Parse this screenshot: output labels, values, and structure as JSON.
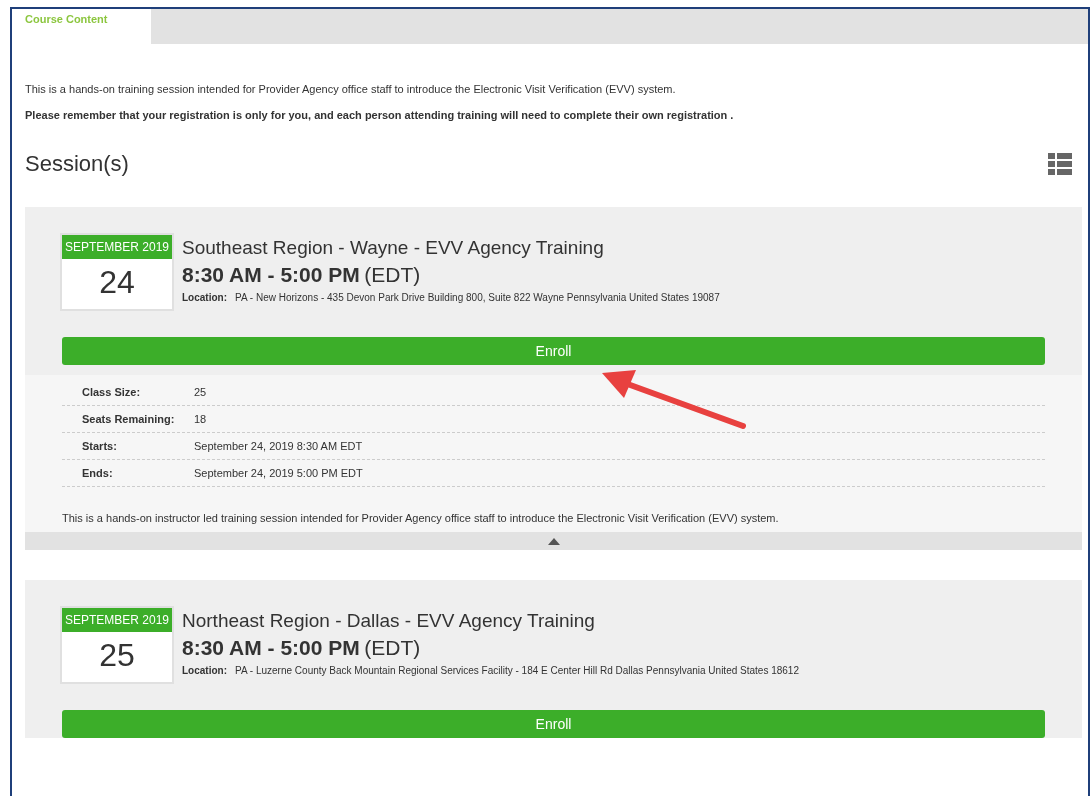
{
  "tabs": [
    {
      "label": "Course Content",
      "selected": true
    }
  ],
  "intro": "This is a hands-on training session intended for Provider Agency office staff to introduce the Electronic Visit Verification (EVV) system.",
  "notice": "Please remember that your registration is only for you, and each person attending training will need to complete their own registration .",
  "sessions_heading": "Session(s)",
  "sessions": [
    {
      "month": "SEPTEMBER 2019",
      "day": "24",
      "title": "Southeast Region - Wayne - EVV Agency Training",
      "time": "8:30 AM - 5:00 PM",
      "zone": "(EDT)",
      "location_label": "Location:",
      "location": "PA - New Horizons - 435 Devon Park Drive Building 800, Suite 822 Wayne Pennsylvania United States 19087",
      "button": "Enroll",
      "expanded": true,
      "details": [
        {
          "label": "Class Size:",
          "value": "25"
        },
        {
          "label": "Seats Remaining:",
          "value": "18"
        },
        {
          "label": "Starts:",
          "value": "September 24, 2019 8:30 AM EDT"
        },
        {
          "label": "Ends:",
          "value": "September 24, 2019 5:00 PM EDT"
        }
      ],
      "description": "This is a hands-on instructor led training session intended for Provider Agency office staff to introduce the Electronic Visit Verification (EVV) system."
    },
    {
      "month": "SEPTEMBER 2019",
      "day": "25",
      "title": "Northeast Region - Dallas - EVV Agency Training",
      "time": "8:30 AM - 5:00 PM",
      "zone": "(EDT)",
      "location_label": "Location:",
      "location": "PA - Luzerne County Back Mountain Regional Services Facility - 184 E Center Hill Rd Dallas Pennsylvania United States 18612",
      "button": "Enroll",
      "expanded": false
    }
  ]
}
